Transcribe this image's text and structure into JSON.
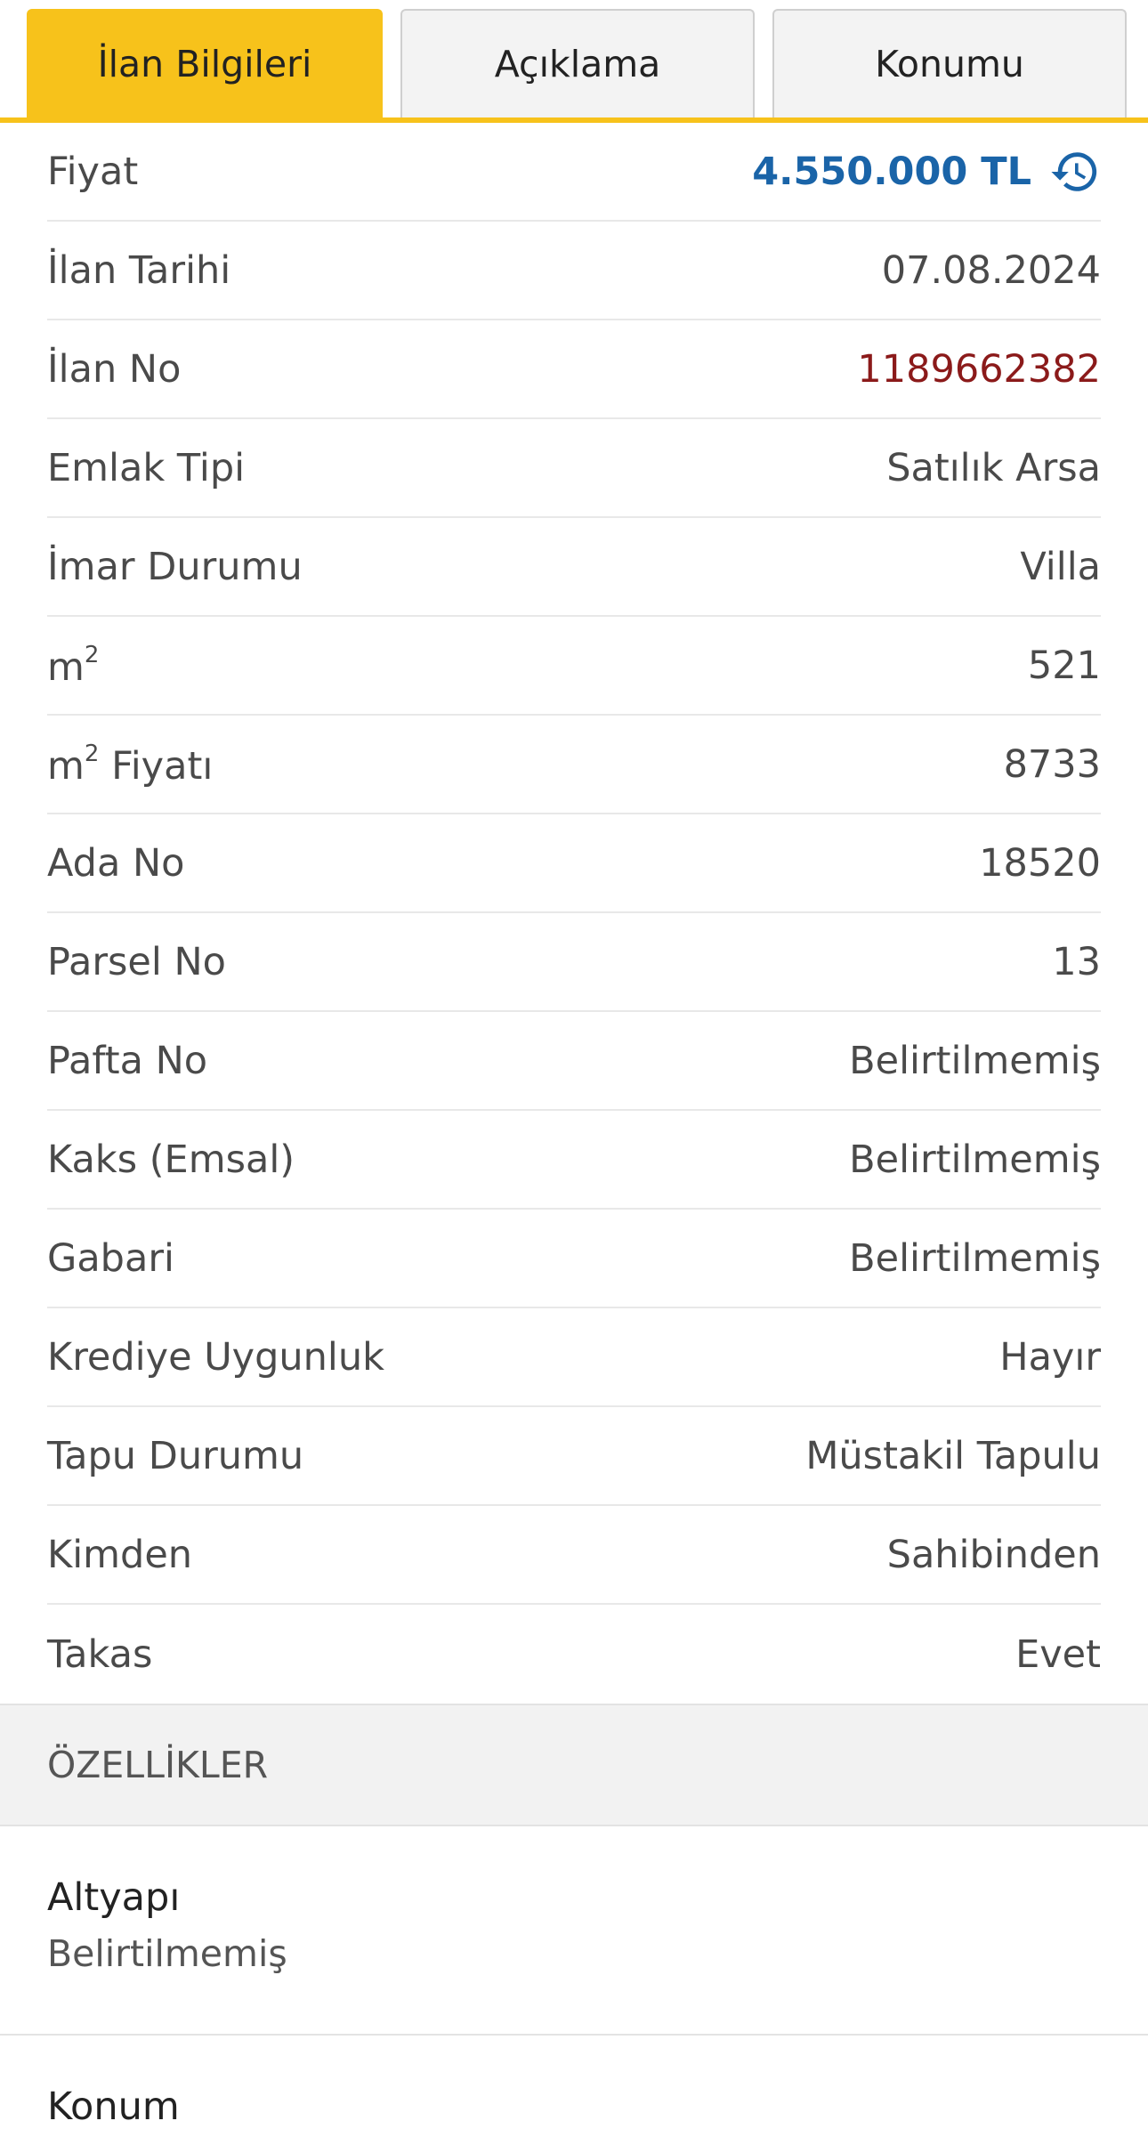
{
  "tabs": [
    {
      "label": "İlan Bilgileri",
      "active": true
    },
    {
      "label": "Açıklama",
      "active": false
    },
    {
      "label": "Konumu",
      "active": false
    }
  ],
  "details": {
    "price": {
      "label": "Fiyat",
      "value": "4.550.000 TL",
      "icon": "price-history-icon"
    },
    "date": {
      "label": "İlan Tarihi",
      "value": "07.08.2024"
    },
    "listing_no": {
      "label": "İlan No",
      "value": "1189662382"
    },
    "property_type": {
      "label": "Emlak Tipi",
      "value": "Satılık Arsa"
    },
    "zoning": {
      "label": "İmar Durumu",
      "value": "Villa"
    },
    "area": {
      "label": "m",
      "label_sup": "2",
      "value": "521"
    },
    "price_per_m2": {
      "label_prefix": "m",
      "label_sup": "2",
      "label_suffix": " Fiyatı",
      "value": "8733"
    },
    "block_no": {
      "label": "Ada No",
      "value": "18520"
    },
    "parcel_no": {
      "label": "Parsel No",
      "value": "13"
    },
    "sheet_no": {
      "label": "Pafta No",
      "value": "Belirtilmemiş"
    },
    "kaks": {
      "label": "Kaks (Emsal)",
      "value": "Belirtilmemiş"
    },
    "gabari": {
      "label": "Gabari",
      "value": "Belirtilmemiş"
    },
    "credit": {
      "label": "Krediye Uygunluk",
      "value": "Hayır"
    },
    "deed": {
      "label": "Tapu Durumu",
      "value": "Müstakil Tapulu"
    },
    "from": {
      "label": "Kimden",
      "value": "Sahibinden"
    },
    "swap": {
      "label": "Takas",
      "value": "Evet"
    }
  },
  "features": {
    "header": "ÖZELLİKLER",
    "items": [
      {
        "title": "Altyapı",
        "value": "Belirtilmemiş"
      },
      {
        "title": "Konum",
        "value": ""
      }
    ]
  },
  "colors": {
    "accent": "#f7c21b",
    "price": "#1a64a8",
    "listing_no": "#8b1a1a"
  }
}
